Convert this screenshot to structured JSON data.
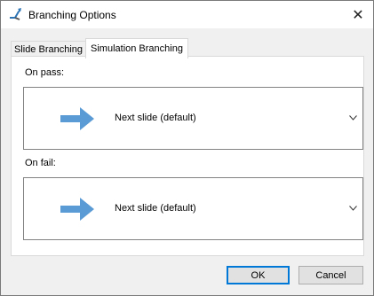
{
  "window": {
    "title": "Branching Options",
    "close_glyph": "✕",
    "icon": "branching-icon"
  },
  "tabs": [
    {
      "label": "Slide Branching",
      "selected": false
    },
    {
      "label": "Simulation Branching",
      "selected": true
    }
  ],
  "on_pass": {
    "label": "On pass:",
    "value": "Next slide (default)",
    "icon": "arrow-right-icon"
  },
  "on_fail": {
    "label": "On fail:",
    "value": "Next slide (default)",
    "icon": "arrow-right-icon"
  },
  "buttons": {
    "ok": "OK",
    "cancel": "Cancel"
  },
  "colors": {
    "arrow": "#5b9bd5",
    "icon_accent": "#2e75b6",
    "focus_border": "#0078d7"
  }
}
